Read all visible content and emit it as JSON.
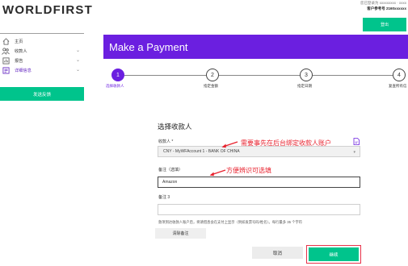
{
  "brand": {
    "logo_text": "WORLDFIRST"
  },
  "account": {
    "logged_in_as": "您已登录为 xxxxxxxxx · xxxx",
    "ref_line": "客户参考号 2160xxxxxx",
    "logout_label": "登出"
  },
  "sidebar": {
    "items": [
      {
        "label": "主页",
        "icon": "home-icon"
      },
      {
        "label": "收款人",
        "icon": "payees-icon"
      },
      {
        "label": "报告",
        "icon": "report-icon"
      },
      {
        "label": "详细信息",
        "icon": "details-icon"
      }
    ],
    "feedback_label": "发送反馈"
  },
  "page": {
    "title": "Make a Payment"
  },
  "steps": [
    {
      "number": "1",
      "label": "选择收款人"
    },
    {
      "number": "2",
      "label": "指定金额"
    },
    {
      "number": "3",
      "label": "指定日期"
    },
    {
      "number": "4",
      "label": "复查所有信"
    }
  ],
  "form": {
    "title": "选择收款人",
    "payee_label": "收款人 *",
    "payee_value": "CNY - MyWFAccount 1 - BANK OF CHINA",
    "note_label": "备注（选填）",
    "note_value": "Amazon",
    "note3_label": "备注 3",
    "note3_value": "",
    "hint": "款项到达收款人账户后，将请借息会在支付上显示（例如发票号码/姓名）。每行最多 35 个字符",
    "clear_label": "清除备注",
    "cancel_label": "取消",
    "continue_label": "继续"
  },
  "annotations": {
    "payee_note": "需要事先在后台绑定收款人账户",
    "remark_note": "方便辨识可选填"
  },
  "colors": {
    "brand_purple": "#6b1fe0",
    "brand_green": "#00c48c",
    "annotation_red": "#e8222e"
  }
}
